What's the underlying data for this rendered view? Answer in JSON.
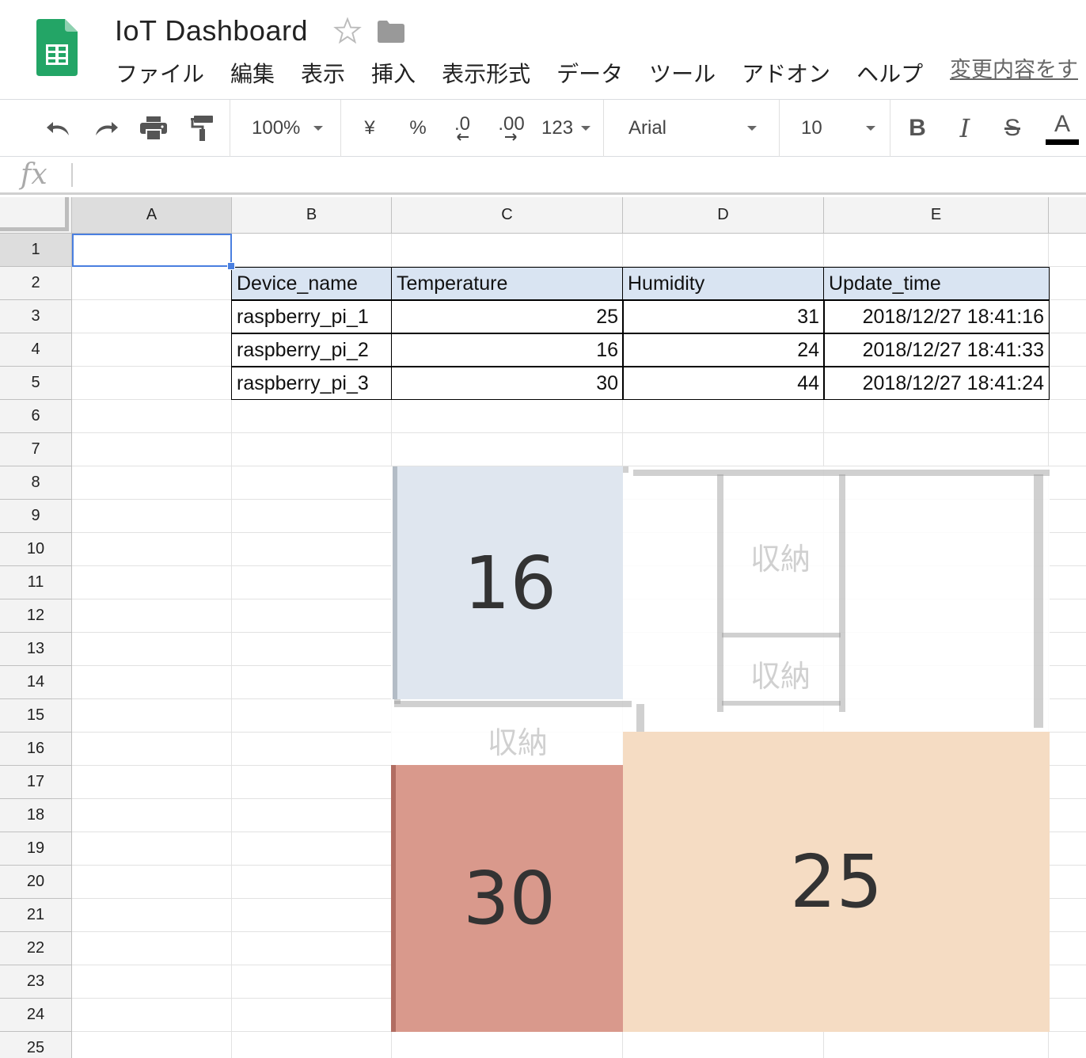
{
  "document": {
    "title": "IoT Dashboard",
    "last_edit_link": "変更内容をす"
  },
  "menu": [
    "ファイル",
    "編集",
    "表示",
    "挿入",
    "表示形式",
    "データ",
    "ツール",
    "アドオン",
    "ヘルプ"
  ],
  "toolbar": {
    "zoom": "100%",
    "currency": "¥",
    "percent": "%",
    "decrease_decimal": ".0",
    "increase_decimal": ".00",
    "number_format": "123",
    "font_family": "Arial",
    "font_size": "10",
    "bold": "B",
    "italic": "I",
    "strikethrough": "S",
    "text_color": "A",
    "text_color_value": "#000000"
  },
  "formula_bar": {
    "fx_label": "fx",
    "value": ""
  },
  "columns": [
    "A",
    "B",
    "C",
    "D",
    "E"
  ],
  "rows": [
    "1",
    "2",
    "3",
    "4",
    "5",
    "6",
    "7",
    "8",
    "9",
    "10",
    "11",
    "12",
    "13",
    "14",
    "15",
    "16",
    "17",
    "18",
    "19",
    "20",
    "21",
    "22",
    "23",
    "24",
    "25"
  ],
  "table": {
    "headers": [
      "Device_name",
      "Temperature",
      "Humidity",
      "Update_time"
    ],
    "rows": [
      [
        "raspberry_pi_1",
        "25",
        "31",
        "2018/12/27 18:41:16"
      ],
      [
        "raspberry_pi_2",
        "16",
        "24",
        "2018/12/27 18:41:33"
      ],
      [
        "raspberry_pi_3",
        "30",
        "44",
        "2018/12/27 18:41:24"
      ]
    ]
  },
  "floorplan": {
    "rooms": [
      {
        "value": "16",
        "color": "#dfe6ef"
      },
      {
        "value": "30",
        "color": "#d9998c"
      },
      {
        "value": "25",
        "color": "#f5dcc3"
      }
    ],
    "storage_labels": [
      "収納",
      "収納",
      "収納"
    ]
  },
  "colors": {
    "selection": "#4a7fe0",
    "table_header_bg": "#d9e4f2",
    "sheets_green": "#23a566"
  }
}
